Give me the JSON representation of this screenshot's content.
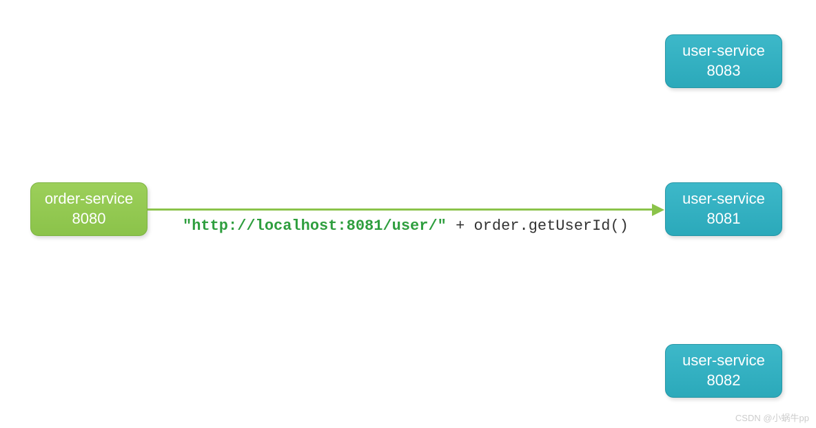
{
  "nodes": {
    "order_service": {
      "name": "order-service",
      "port": "8080"
    },
    "user_service_8083": {
      "name": "user-service",
      "port": "8083"
    },
    "user_service_8081": {
      "name": "user-service",
      "port": "8081"
    },
    "user_service_8082": {
      "name": "user-service",
      "port": "8082"
    }
  },
  "arrow": {
    "label_url": "\"http://localhost:8081/user/\"",
    "label_expr": " + order.getUserId()"
  },
  "watermark": "CSDN @小蜗牛pp"
}
